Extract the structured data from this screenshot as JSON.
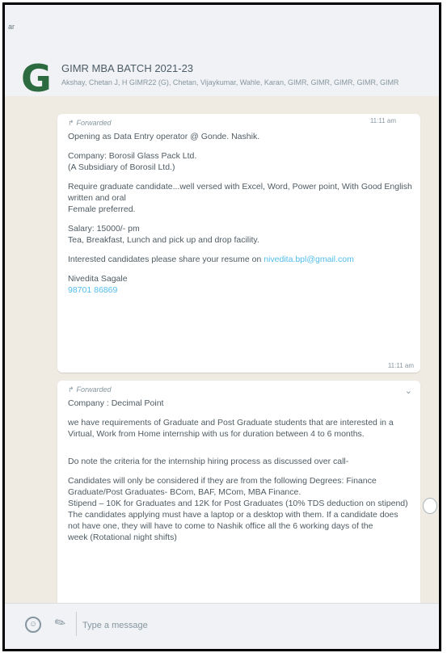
{
  "topbar": {
    "corner": "ar"
  },
  "header": {
    "avatar_letter": "G",
    "title": "GIMR MBA BATCH 2021-23",
    "members": "Akshay, Chetan J, H GIMR22 (G), Chetan, Vijaykumar, Wahle, Karan, GIMR, GIMR, GIMR, GIMR, GIMR"
  },
  "messages": [
    {
      "forwarded_label": "Forwarded",
      "previous_time": "11:11 am",
      "lines": [
        "Opening as Data Entry operator @ Gonde. Nashik.",
        "",
        "Company: Borosil Glass Pack Ltd.",
        "(A Subsidiary of Borosil Ltd.)",
        "",
        "Require graduate candidate...well versed with Excel, Word, Power point, With Good English",
        "written and oral",
        "Female preferred.",
        "",
        "Salary: 15000/- pm",
        "Tea, Breakfast, Lunch and pick up and drop facility.",
        "",
        "Interested candidates please share your resume on ",
        "",
        "Nivedita Sagale",
        ""
      ],
      "email": "nivedita.bpl@gmail.com",
      "phone": "98701 86869",
      "time": "11:11 am"
    },
    {
      "forwarded_label": "Forwarded",
      "lines": [
        "Company : Decimal Point",
        "",
        "we have requirements of Graduate and Post Graduate students that are interested in a",
        "Virtual, Work from Home internship with us for duration between 4 to 6 months.",
        "",
        "",
        "Do note the criteria for the internship hiring process as discussed over call-",
        "",
        "Candidates will only be considered if they are from the following Degrees: Finance",
        "Graduate/Post Graduates- BCom, BAF, MCom, MBA Finance.",
        "Stipend – 10K for Graduates and 12K for Post Graduates (10% TDS deduction on stipend)",
        "The candidates applying must have a laptop or a desktop with them. If a candidate does",
        "not have one, they will have to come to Nashik office all the 6 working days of the",
        "week (Rotational night shifts)"
      ]
    }
  ],
  "composer": {
    "placeholder": "Type a message"
  }
}
